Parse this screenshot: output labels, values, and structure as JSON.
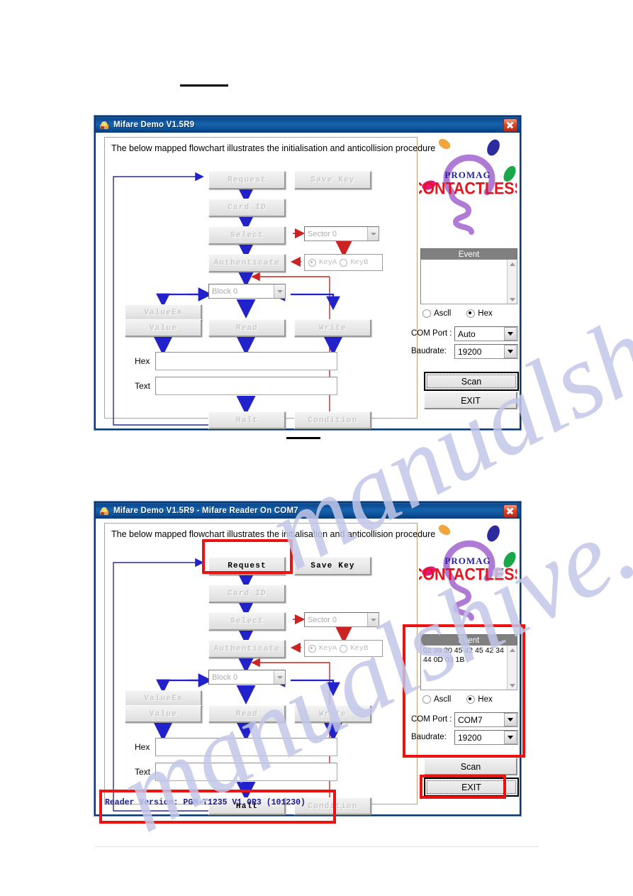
{
  "page": {
    "redactions": 2
  },
  "window1": {
    "title": "Mifare Demo V1.5R9",
    "hint": "The below mapped flowchart illustrates the initialisation and anticollision procedure",
    "flow": {
      "request": "Request",
      "save_key": "Save Key",
      "card_id": "Card ID",
      "select": "Select",
      "authenticate": "Authenticate",
      "value_ex": "ValueEx",
      "value": "Value",
      "read": "Read",
      "write": "Write",
      "halt": "Halt",
      "condition": "Condition"
    },
    "sector_combo": "Sector 0",
    "block_combo": "Block 0",
    "keya": "KeyA",
    "keyb": "KeyB",
    "hex_label": "Hex",
    "text_label": "Text",
    "hex_value": "",
    "text_value": "",
    "panel": {
      "event_header": "Event",
      "event_text": "",
      "ascii_label": "Ascll",
      "hex_label": "Hex",
      "format_selected": "Hex",
      "comport_label": "COM Port :",
      "comport_value": "Auto",
      "baudrate_label": "Baudrate:",
      "baudrate_value": "19200",
      "scan_button": "Scan",
      "exit_button": "EXIT",
      "focused_button": "Scan"
    },
    "logo": {
      "brand": "PROMAG",
      "product": "CONTACTLESS",
      "brand_color": "#2222aa",
      "product_color": "#e8141c",
      "bulb_color": "#b07bd4"
    }
  },
  "window2": {
    "title": "Mifare Demo V1.5R9 - Mifare Reader On COM7",
    "hint": "The below mapped flowchart illustrates the initialisation and anticollision procedure",
    "flow": {
      "request": "Request",
      "save_key": "Save Key",
      "card_id": "Card ID",
      "select": "Select",
      "authenticate": "Authenticate",
      "value_ex": "ValueEx",
      "value": "Value",
      "read": "Read",
      "write": "Write",
      "halt": "Halt",
      "condition": "Condition"
    },
    "sector_combo": "Sector 0",
    "block_combo": "Block 0",
    "keya": "KeyA",
    "keyb": "KeyB",
    "hex_label": "Hex",
    "text_label": "Text",
    "hex_value": "",
    "text_value": "",
    "status_line": "Reader Version: PGM-T1235 V1.0R3 (101230)",
    "panel": {
      "event_header": "Event",
      "event_text": "02 39 30 45 42 45 42 34 44 0D 03 1B",
      "ascii_label": "Ascll",
      "hex_label": "Hex",
      "format_selected": "Hex",
      "comport_label": "COM Port :",
      "comport_value": "COM7",
      "baudrate_label": "Baudrate:",
      "baudrate_value": "19200",
      "scan_button": "Scan",
      "exit_button": "EXIT",
      "focused_button": "EXIT"
    },
    "logo": {
      "brand": "PROMAG",
      "product": "CONTACTLESS",
      "brand_color": "#2222aa",
      "product_color": "#e8141c",
      "bulb_color": "#b07bd4"
    },
    "highlights": {
      "request_box": "Request",
      "panel_box": "Event / COM Port panel",
      "exit_box": "EXIT",
      "status_box": "Reader Version"
    }
  },
  "watermark": {
    "text1": "manualshive.com",
    "text2": "manualshive.com",
    "color": "#c3c7e8"
  },
  "colors": {
    "highlight": "#ee1111",
    "title_bar": "#0a4a91",
    "group_border": "#caa06a",
    "arrow_blue": "#2222cc",
    "arrow_red": "#cc2222",
    "status_text": "#1b1b8c"
  }
}
